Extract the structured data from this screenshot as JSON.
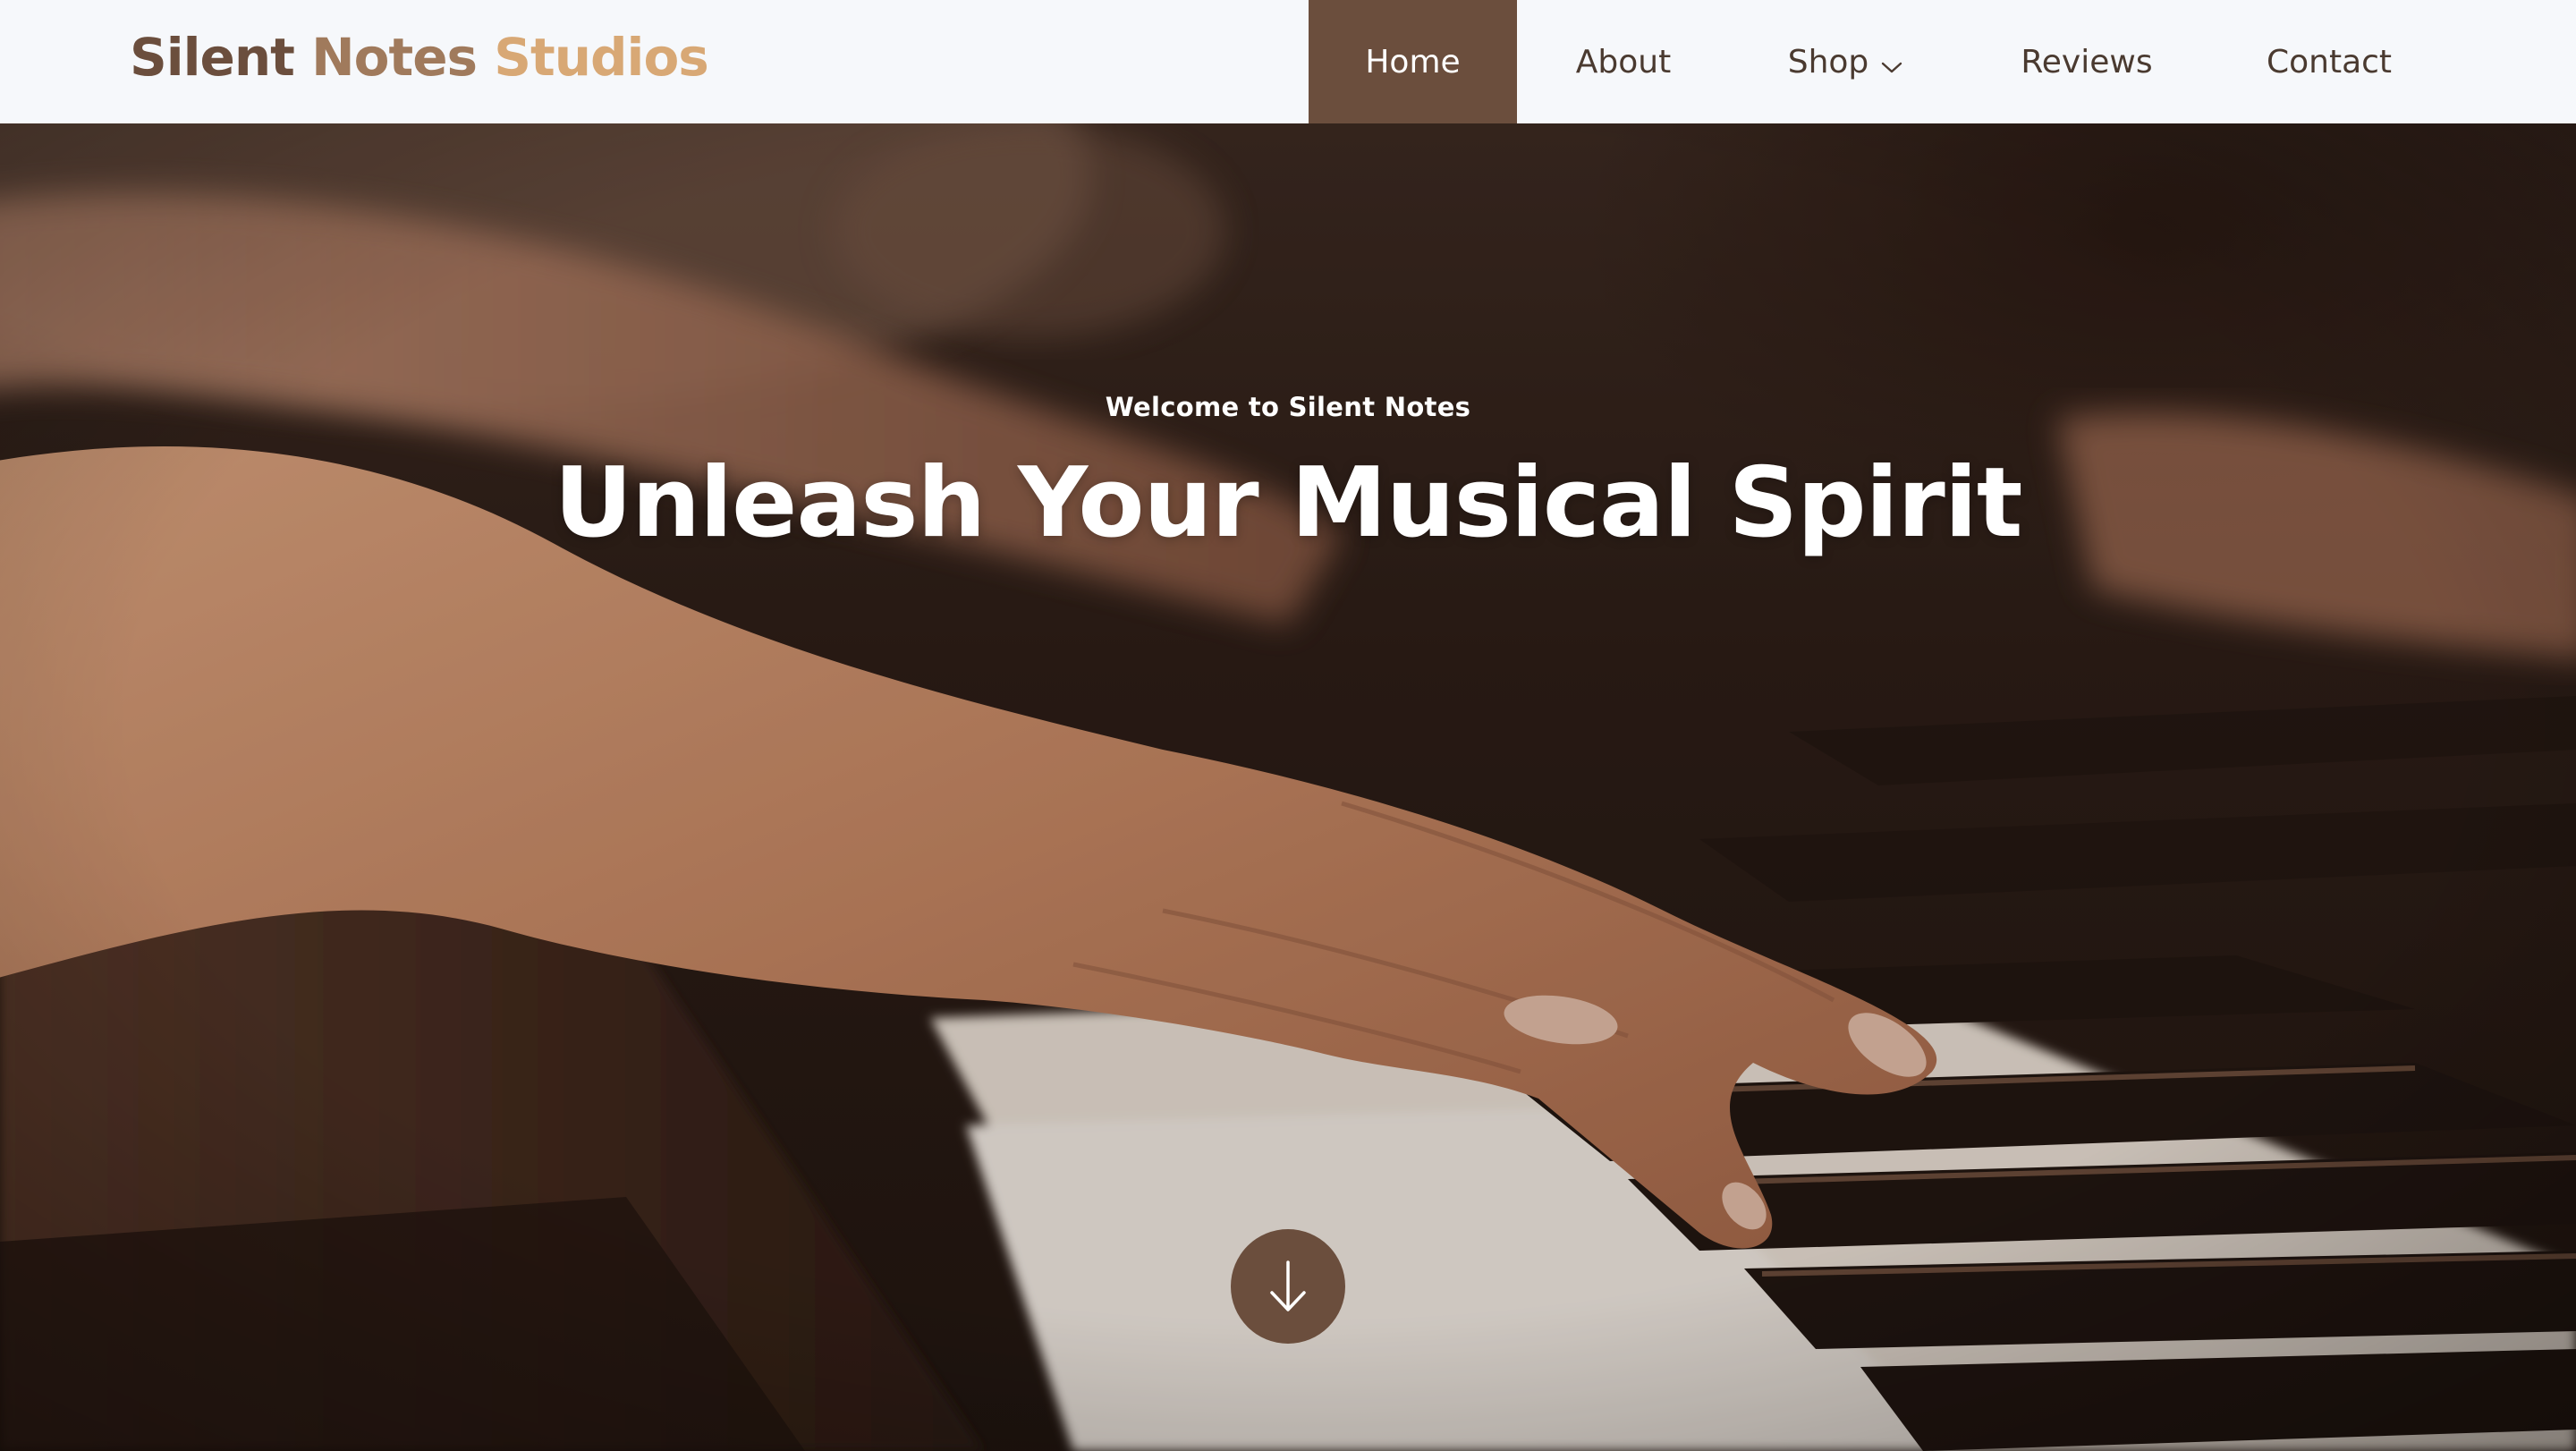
{
  "header": {
    "logo": {
      "word1": "Silent",
      "word2": " Notes",
      "word3": " Studios",
      "color1": "#6b4e3d",
      "color2": "#a07a5c",
      "color3": "#d8a875"
    },
    "nav": [
      {
        "label": "Home",
        "active": true
      },
      {
        "label": "About",
        "active": false
      },
      {
        "label": "Shop",
        "active": false,
        "icon": "chevron-down-icon"
      },
      {
        "label": "Reviews",
        "active": false
      },
      {
        "label": "Contact",
        "active": false
      }
    ]
  },
  "hero": {
    "kicker": "Welcome to Silent Notes",
    "title": "Unleash Your Musical Spirit",
    "background_image": "hands playing piano keys",
    "scroll_icon": "arrow-down-icon"
  },
  "colors": {
    "accent": "#6b4e3d",
    "header_bg": "#f6f8fb",
    "nav_text": "#4a3a30"
  }
}
